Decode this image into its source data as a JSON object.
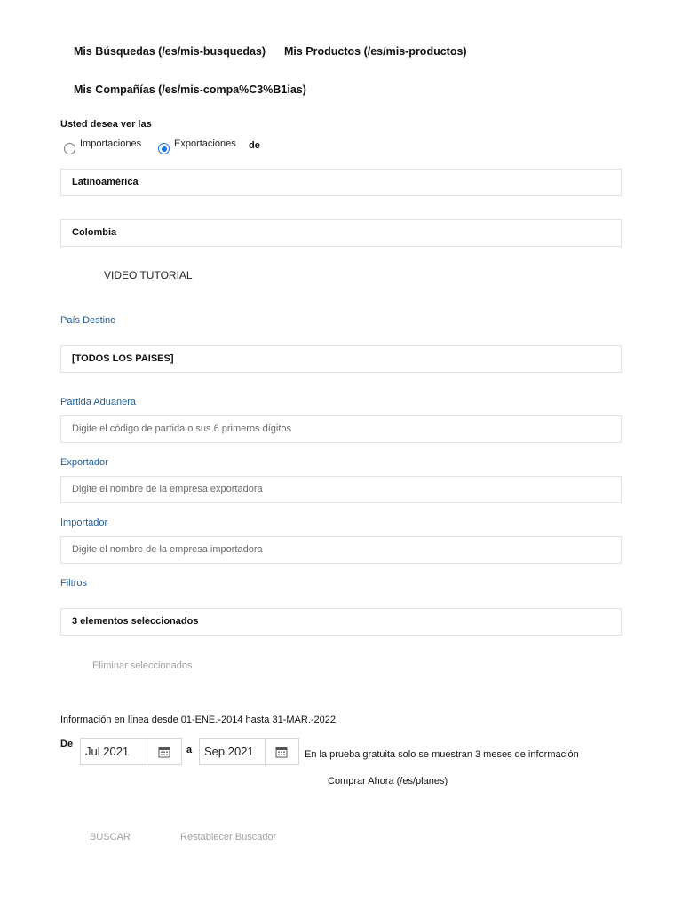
{
  "nav": {
    "mis_busquedas": "Mis Búsquedas (/es/mis-busquedas)",
    "mis_productos": "Mis Productos (/es/mis-productos)",
    "mis_companias": "Mis Compañías (/es/mis-compa%C3%B1ias)"
  },
  "view_selector": {
    "prompt": "Usted desea ver las",
    "option_importaciones": "Importaciones",
    "option_exportaciones": "Exportaciones",
    "selected": "Exportaciones",
    "suffix": "de"
  },
  "region": {
    "value": "Latinoamérica"
  },
  "country": {
    "value": "Colombia"
  },
  "video_tutorial": "VIDEO TUTORIAL",
  "pais_destino": {
    "label": "País Destino",
    "value": "[TODOS LOS PAISES]"
  },
  "partida": {
    "label": "Partida Aduanera",
    "placeholder": "Digite el código de partida o sus 6 primeros dígitos"
  },
  "exportador": {
    "label": "Exportador",
    "placeholder": "Digite el nombre de la empresa exportadora"
  },
  "importador": {
    "label": "Importador",
    "placeholder": "Digite el nombre de la empresa importadora"
  },
  "filtros": {
    "label": "Filtros",
    "value": "3 elementos seleccionados",
    "remove_label": "Eliminar seleccionados"
  },
  "info_range": "Información en línea desde 01-ENE.-2014 hasta 31-MAR.-2022",
  "dates": {
    "from_label": "De",
    "from_value": "Jul 2021",
    "to_label": "a",
    "to_value": "Sep 2021",
    "trial_note": "En la prueba gratuita solo se muestran 3 meses de información",
    "buy_link": "Comprar Ahora (/es/planes)"
  },
  "actions": {
    "search": "BUSCAR",
    "reset": "Restablecer Buscador"
  },
  "colors": {
    "label_blue": "#1f5f99",
    "radio_blue": "#1a73e8",
    "muted": "#a0a0a0"
  }
}
